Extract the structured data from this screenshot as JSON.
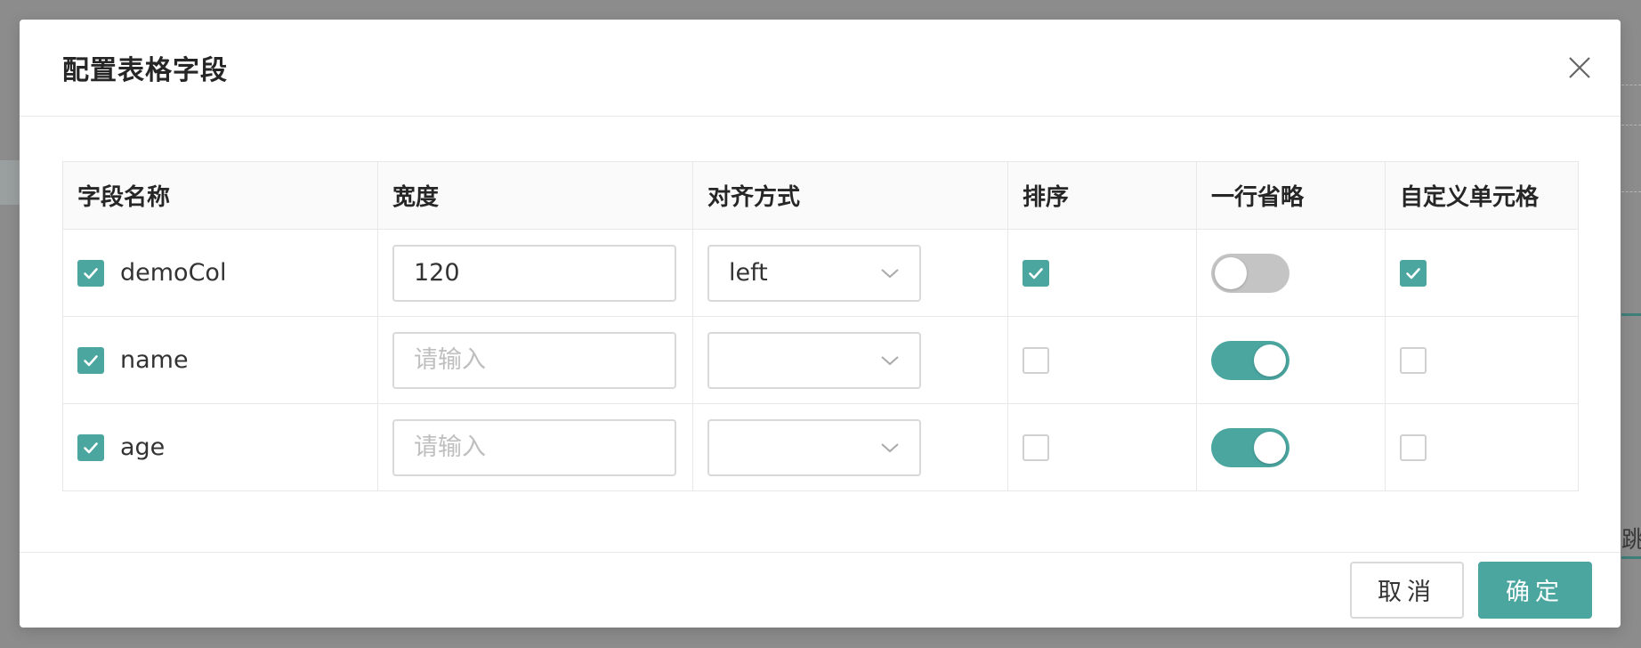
{
  "dialog": {
    "title": "配置表格字段",
    "close_icon": "close-icon"
  },
  "table": {
    "headers": [
      "字段名称",
      "宽度",
      "对齐方式",
      "排序",
      "一行省略",
      "自定义单元格"
    ],
    "rows": [
      {
        "selected": true,
        "name": "demoCol",
        "width": "120",
        "width_placeholder": "请输入",
        "align": "left",
        "sortable": true,
        "ellipsis": false,
        "custom_cell": true
      },
      {
        "selected": true,
        "name": "name",
        "width": "",
        "width_placeholder": "请输入",
        "align": "",
        "sortable": false,
        "ellipsis": true,
        "custom_cell": false
      },
      {
        "selected": true,
        "name": "age",
        "width": "",
        "width_placeholder": "请输入",
        "align": "",
        "sortable": false,
        "ellipsis": true,
        "custom_cell": false
      }
    ]
  },
  "footer": {
    "cancel_label": "取消",
    "ok_label": "确定"
  },
  "colors": {
    "accent": "#4ba6a0",
    "switch_off": "#c4c4c4"
  },
  "background": {
    "partial_text": "跳至"
  }
}
